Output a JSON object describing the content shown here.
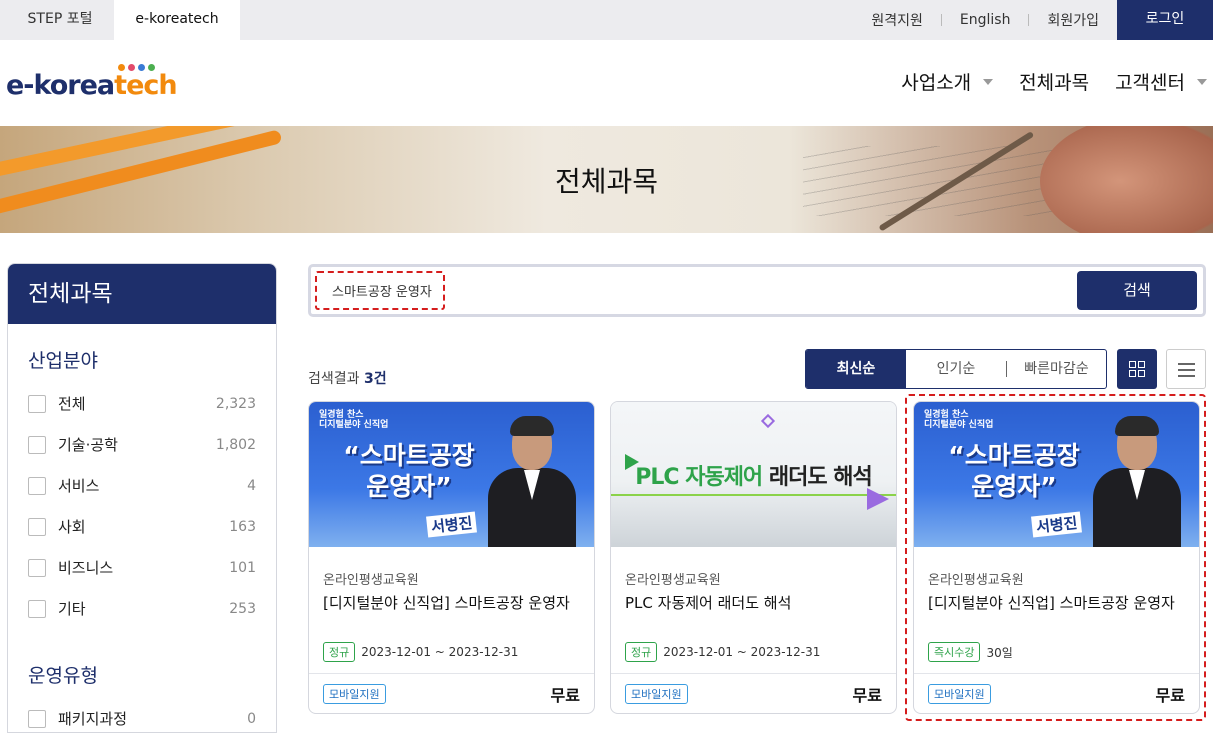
{
  "topbar": {
    "tabs": [
      {
        "label": "STEP 포털"
      },
      {
        "label": "e-koreatech"
      }
    ],
    "links": [
      "원격지원",
      "English",
      "회원가입"
    ],
    "login": "로그인"
  },
  "logo": {
    "part1": "e-korea",
    "part2": "tech",
    "dot_colors": [
      "#f28a0d",
      "#e24b6b",
      "#3a7bd5",
      "#4caf50"
    ]
  },
  "nav": [
    {
      "label": "사업소개",
      "dropdown": true
    },
    {
      "label": "전체과목",
      "dropdown": false
    },
    {
      "label": "고객센터",
      "dropdown": true
    }
  ],
  "banner": {
    "title": "전체과목"
  },
  "sidebar": {
    "title": "전체과목",
    "sections": [
      {
        "title": "산업분야",
        "items": [
          {
            "label": "전체",
            "count": "2,323"
          },
          {
            "label": "기술·공학",
            "count": "1,802"
          },
          {
            "label": "서비스",
            "count": "4"
          },
          {
            "label": "사회",
            "count": "163"
          },
          {
            "label": "비즈니스",
            "count": "101"
          },
          {
            "label": "기타",
            "count": "253"
          }
        ]
      },
      {
        "title": "운영유형",
        "items": [
          {
            "label": "패키지과정",
            "count": "0"
          }
        ]
      }
    ]
  },
  "search": {
    "value": "스마트공장 운영자",
    "button": "검색"
  },
  "results": {
    "prefix": "검색결과",
    "count": "3건"
  },
  "sort": {
    "options": [
      "최신순",
      "인기순",
      "빠른마감순"
    ],
    "active": "최신순"
  },
  "colors": {
    "primary": "#1e2f6b",
    "accent": "#f28a0d",
    "highlight": "#d51d1d",
    "tag_green": "#2ea34a",
    "tag_blue": "#3a9ce0"
  },
  "cards": [
    {
      "thumb": {
        "logo_line1": "일경험 찬스",
        "logo_line2": "디지털분야 신직업",
        "title_line1": "“스마트공장",
        "title_line2": "운영자”",
        "instructor": "서병진"
      },
      "org": "온라인평생교육원",
      "title": "[디지털분야 신직업] 스마트공장 운영자",
      "tag": "정규",
      "period": "2023-12-01 ~ 2023-12-31",
      "mobile": "모바일지원",
      "price": "무료"
    },
    {
      "thumb": {
        "title_green": "PLC 자동제어",
        "title_rest": " 래더도 해석"
      },
      "org": "온라인평생교육원",
      "title": "PLC 자동제어 래더도 해석",
      "tag": "정규",
      "period": "2023-12-01 ~ 2023-12-31",
      "mobile": "모바일지원",
      "price": "무료"
    },
    {
      "thumb": {
        "logo_line1": "일경험 찬스",
        "logo_line2": "디지털분야 신직업",
        "title_line1": "“스마트공장",
        "title_line2": "운영자”",
        "instructor": "서병진"
      },
      "org": "온라인평생교육원",
      "title": "[디지털분야 신직업] 스마트공장 운영자",
      "tag": "즉시수강",
      "period": "30일",
      "mobile": "모바일지원",
      "price": "무료"
    }
  ]
}
